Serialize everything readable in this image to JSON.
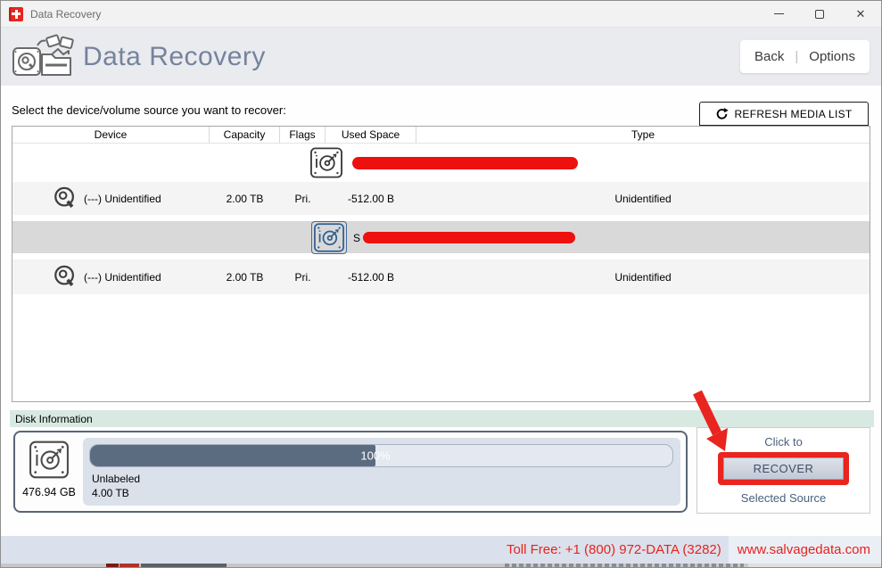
{
  "window": {
    "title": "Data Recovery"
  },
  "titlebar": {
    "icons": {
      "close": "✕"
    }
  },
  "header": {
    "title": "Data Recovery",
    "back_label": "Back",
    "divider": "|",
    "options_label": "Options"
  },
  "main": {
    "select_label": "Select the device/volume source you want to recover:",
    "refresh_label": "REFRESH MEDIA LIST"
  },
  "table": {
    "columns": [
      "Device",
      "Capacity",
      "Flags",
      "Used Space",
      "Type"
    ],
    "rows": [
      {
        "kind": "disk",
        "device_redacted": true,
        "visible_prefix": "",
        "selected": false
      },
      {
        "kind": "volume",
        "device": "(---) Unidentified",
        "capacity": "2.00 TB",
        "flags": "Pri.",
        "used_space": "-512.00 B",
        "type": "Unidentified"
      },
      {
        "kind": "disk",
        "device_redacted": true,
        "visible_prefix": "S",
        "selected": true
      },
      {
        "kind": "volume",
        "device": "(---) Unidentified",
        "capacity": "2.00 TB",
        "flags": "Pri.",
        "used_space": "-512.00 B",
        "type": "Unidentified"
      }
    ]
  },
  "disk_information": {
    "section_label": "Disk Information",
    "size_label": "476.94 GB",
    "progress_label": "100%",
    "progress_fill_percent": 49,
    "volume_label": "Unlabeled",
    "volume_capacity": "4.00 TB"
  },
  "recover_panel": {
    "line1": "Click to",
    "button_label": "RECOVER",
    "line2": "Selected Source"
  },
  "footer": {
    "toll_free": "Toll Free: +1 (800) 972-DATA (3282)",
    "website": "www.salvagedata.com"
  },
  "colors": {
    "accent_red": "#e8251f",
    "redaction_red": "#ee0f0f",
    "selected_row": "#d9d9d9",
    "progress_fill": "#5b6c81",
    "mint_strip": "#d8e9e2",
    "footer_bg": "#dbe1ec",
    "link_red": "#e6231d"
  }
}
